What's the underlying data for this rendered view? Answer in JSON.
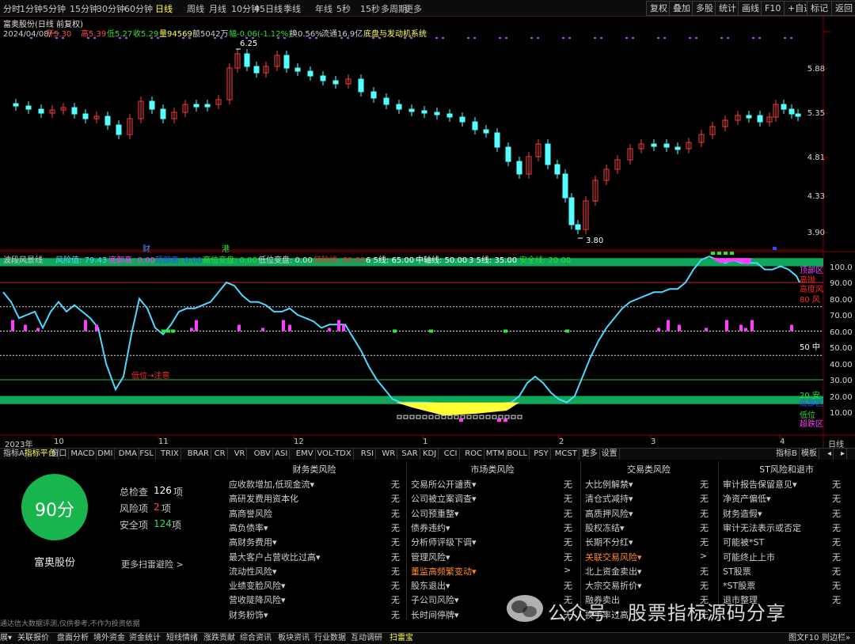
{
  "toolbar": {
    "left_items": [
      "分时",
      "1分钟",
      "5分钟",
      "15分钟",
      "30分钟",
      "60分钟",
      "日线",
      "周线",
      "月线",
      "10分钟",
      "45日线",
      "季线",
      "年线",
      "5秒",
      "15秒",
      "多周期",
      "更多"
    ],
    "active": "日线",
    "right_buttons": [
      "复权",
      "叠加",
      "多股",
      "统计",
      "画线",
      "F10",
      "+自选",
      "标记",
      "返回"
    ]
  },
  "info": {
    "title": "富奥股份(日线 前复权)",
    "date": "2024/04/08/一",
    "open": "开5.30",
    "high": "高5.39",
    "low": "低5.27",
    "close": "收5.29",
    "volume": "量94569",
    "amount": "额5042万",
    "change": "幅-0.06(-1.12%)",
    "turnover": "换0.56%",
    "float": "流通16.9亿",
    "system": "底盘与发动机系统"
  },
  "price_axis": [
    "5.88",
    "5.35",
    "4.81",
    "4.33",
    "3.90"
  ],
  "price_marks": {
    "high": "6.25",
    "low": "3.80"
  },
  "markers": {
    "cai": "财",
    "gang": "港"
  },
  "indicator": {
    "name": "波段风景线",
    "items": [
      {
        "text": "风险值: 79.43",
        "color": "#4fd8ff"
      },
      {
        "text": "底部高: 0.00",
        "color": "#ff3cff"
      },
      {
        "text": "顶部高: 0.00",
        "color": "#2a4bff"
      },
      {
        "text": "高位变盘: 0.00",
        "color": "#33dd33"
      },
      {
        "text": "低位变盘: 0.00",
        "color": "#dddddd"
      },
      {
        "text": "风险线: 80.00",
        "color": "#ff2a2a"
      },
      {
        "text": "6 5线: 65.00",
        "color": "#ffffff"
      },
      {
        "text": "中轴线: 50.00",
        "color": "#ffffff"
      },
      {
        "text": "3 5线: 35.00",
        "color": "#ffffff"
      },
      {
        "text": "安全线: 20.00",
        "color": "#33dd33"
      }
    ],
    "axis": [
      "100.0",
      "90.00",
      "80.00",
      "70.00",
      "60.00",
      "50.00",
      "40.00",
      "30.00",
      "20.00",
      "10.00"
    ],
    "right_labels": [
      {
        "text": "顶部区",
        "color": "#ff3cff"
      },
      {
        "text": "高抛",
        "color": "#ff2a2a"
      },
      {
        "text": "高度风",
        "color": "#ff2a2a"
      },
      {
        "text": "80 风",
        "color": "#ff2a2a"
      },
      {
        "text": "50 中",
        "color": "#ffffff"
      },
      {
        "text": "20 安",
        "color": "#33dd33"
      },
      {
        "text": "底部区",
        "color": "#2a4bff"
      },
      {
        "text": "低位",
        "color": "#33dd33"
      },
      {
        "text": "超跌区",
        "color": "#ff3cff"
      }
    ],
    "annotation": "低位→注意"
  },
  "time_axis": [
    "2023年",
    "10",
    "11",
    "12",
    "1",
    "2",
    "3",
    "4"
  ],
  "time_axis_right": "日线",
  "tabs": [
    "指标A",
    "指标平台",
    "窗口",
    "MACD",
    "DMI",
    "DMA",
    "FSL",
    "TRIX",
    "BRAR",
    "CR",
    "VR",
    "OBV",
    "ASI",
    "EMV",
    "VOL-TDX",
    "RSI",
    "WR",
    "SAR",
    "KDJ",
    "CCI",
    "ROC",
    "MTM",
    "BOLL",
    "PSY",
    "MCST",
    "更多",
    "设置"
  ],
  "tabs_active": "指标平台",
  "tabs_right": [
    "指标B",
    "模板",
    "◂",
    "▸"
  ],
  "risk": {
    "score": "90分",
    "stock": "富奥股份",
    "total_label": "总检查",
    "total_value": "126",
    "risk_label": "风险项",
    "risk_value": "2",
    "safe_label": "安全项",
    "safe_value": "124",
    "unit": "项",
    "more": "更多扫雷避险 >",
    "disclaimer": "通达信大数据评测,仅供参考,不作为投资依据",
    "columns": [
      {
        "title": "财务类风险",
        "rows": [
          {
            "label": "应收款增加,低现金流▾",
            "val": "无"
          },
          {
            "label": "高研发费用资本化",
            "val": "无"
          },
          {
            "label": "高商誉风险",
            "val": "无"
          },
          {
            "label": "高负债率▾",
            "val": "无"
          },
          {
            "label": "高财务费用▾",
            "val": "无"
          },
          {
            "label": "最大客户占营收比过高▾",
            "val": "无"
          },
          {
            "label": "流动性风险▾",
            "val": "无"
          },
          {
            "label": "业绩变脸风险▾",
            "val": "无"
          },
          {
            "label": "营收陡降风险▾",
            "val": "无"
          },
          {
            "label": "财务粉饰▾",
            "val": "无"
          }
        ]
      },
      {
        "title": "市场类风险",
        "rows": [
          {
            "label": "交易所公开谴责▾",
            "val": "无"
          },
          {
            "label": "公司被立案调查▾",
            "val": "无"
          },
          {
            "label": "公司预重整▾",
            "val": "无"
          },
          {
            "label": "债券违约▾",
            "val": "无"
          },
          {
            "label": "分析师评级下调▾",
            "val": "无"
          },
          {
            "label": "管理风险▾",
            "val": "无"
          },
          {
            "label": "董监高频繁变动▾",
            "val": ">",
            "hl": true
          },
          {
            "label": "股东退出▾",
            "val": "无"
          },
          {
            "label": "子公司风险▾",
            "val": "无"
          },
          {
            "label": "长时间停牌▾",
            "val": "无"
          }
        ]
      },
      {
        "title": "交易类风险",
        "rows": [
          {
            "label": "大比例解禁▾",
            "val": "无"
          },
          {
            "label": "清仓式减持▾",
            "val": "无"
          },
          {
            "label": "高质押风险▾",
            "val": "无"
          },
          {
            "label": "股权冻结▾",
            "val": "无"
          },
          {
            "label": "长期不分红▾",
            "val": "无"
          },
          {
            "label": "关联交易风险▾",
            "val": ">",
            "hl": true
          },
          {
            "label": "北上资金卖出▾",
            "val": "无"
          },
          {
            "label": "大宗交易折价▾",
            "val": "无"
          },
          {
            "label": "融券卖出",
            "val": "无"
          },
          {
            "label": "换手率过高",
            "val": "无"
          }
        ]
      },
      {
        "title": "ST风险和退市",
        "rows": [
          {
            "label": "审计报告保留意见▾",
            "val": "无"
          },
          {
            "label": "净资产偏低▾",
            "val": "无"
          },
          {
            "label": "财务造假▾",
            "val": "无"
          },
          {
            "label": "审计无法表示或否定",
            "val": "无"
          },
          {
            "label": "可能被*ST",
            "val": "无"
          },
          {
            "label": "可能终止上市",
            "val": "无"
          },
          {
            "label": "ST股票",
            "val": "无"
          },
          {
            "label": "*ST股票",
            "val": "无"
          },
          {
            "label": "退市整理",
            "val": "无"
          },
          {
            "label": "",
            "val": ""
          }
        ]
      }
    ]
  },
  "watermark": "公众号 · 股票指标源码分享",
  "bottom": {
    "left_items": [
      "展▾",
      "关联报价",
      "盘面分析",
      "境外资金",
      "资金统计",
      "短线情绪",
      "涨跌贡献",
      "综合资讯",
      "板块资讯",
      "行业数据",
      "互动调研",
      "扫雷宝"
    ],
    "active": "扫雷宝",
    "right_items": [
      "图文F10",
      "则边栏»"
    ]
  },
  "colors": {
    "up": "#ff3b3b",
    "down": "#54ffff",
    "band": "#0fa85a",
    "accent": "#ffff55"
  }
}
